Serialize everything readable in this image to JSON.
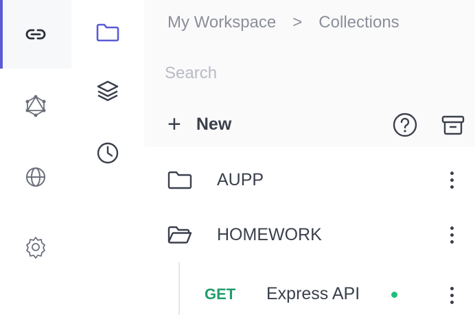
{
  "rail": {
    "items": [
      {
        "icon": "link-icon",
        "active": true
      },
      {
        "icon": "graphql-icon",
        "active": false
      },
      {
        "icon": "globe-icon",
        "active": false
      },
      {
        "icon": "settings-icon",
        "active": false
      }
    ]
  },
  "sidebar": {
    "items": [
      {
        "icon": "folder-icon",
        "active": true
      },
      {
        "icon": "layers-icon",
        "active": false
      },
      {
        "icon": "history-icon",
        "active": false
      }
    ]
  },
  "breadcrumb": {
    "workspace": "My Workspace",
    "separator": ">",
    "current": "Collections"
  },
  "search": {
    "placeholder": "Search",
    "value": ""
  },
  "toolbar": {
    "new_label": "New",
    "new_icon": "+"
  },
  "collections": [
    {
      "name": "AUPP",
      "state": "closed"
    },
    {
      "name": "HOMEWORK",
      "state": "open"
    }
  ],
  "requests": [
    {
      "method": "GET",
      "name": "Express API",
      "status_color": "#1fbf7a"
    }
  ],
  "colors": {
    "accent": "#5b5bd6",
    "get_method": "#1f9d6b",
    "status_dot": "#1fbf7a"
  }
}
